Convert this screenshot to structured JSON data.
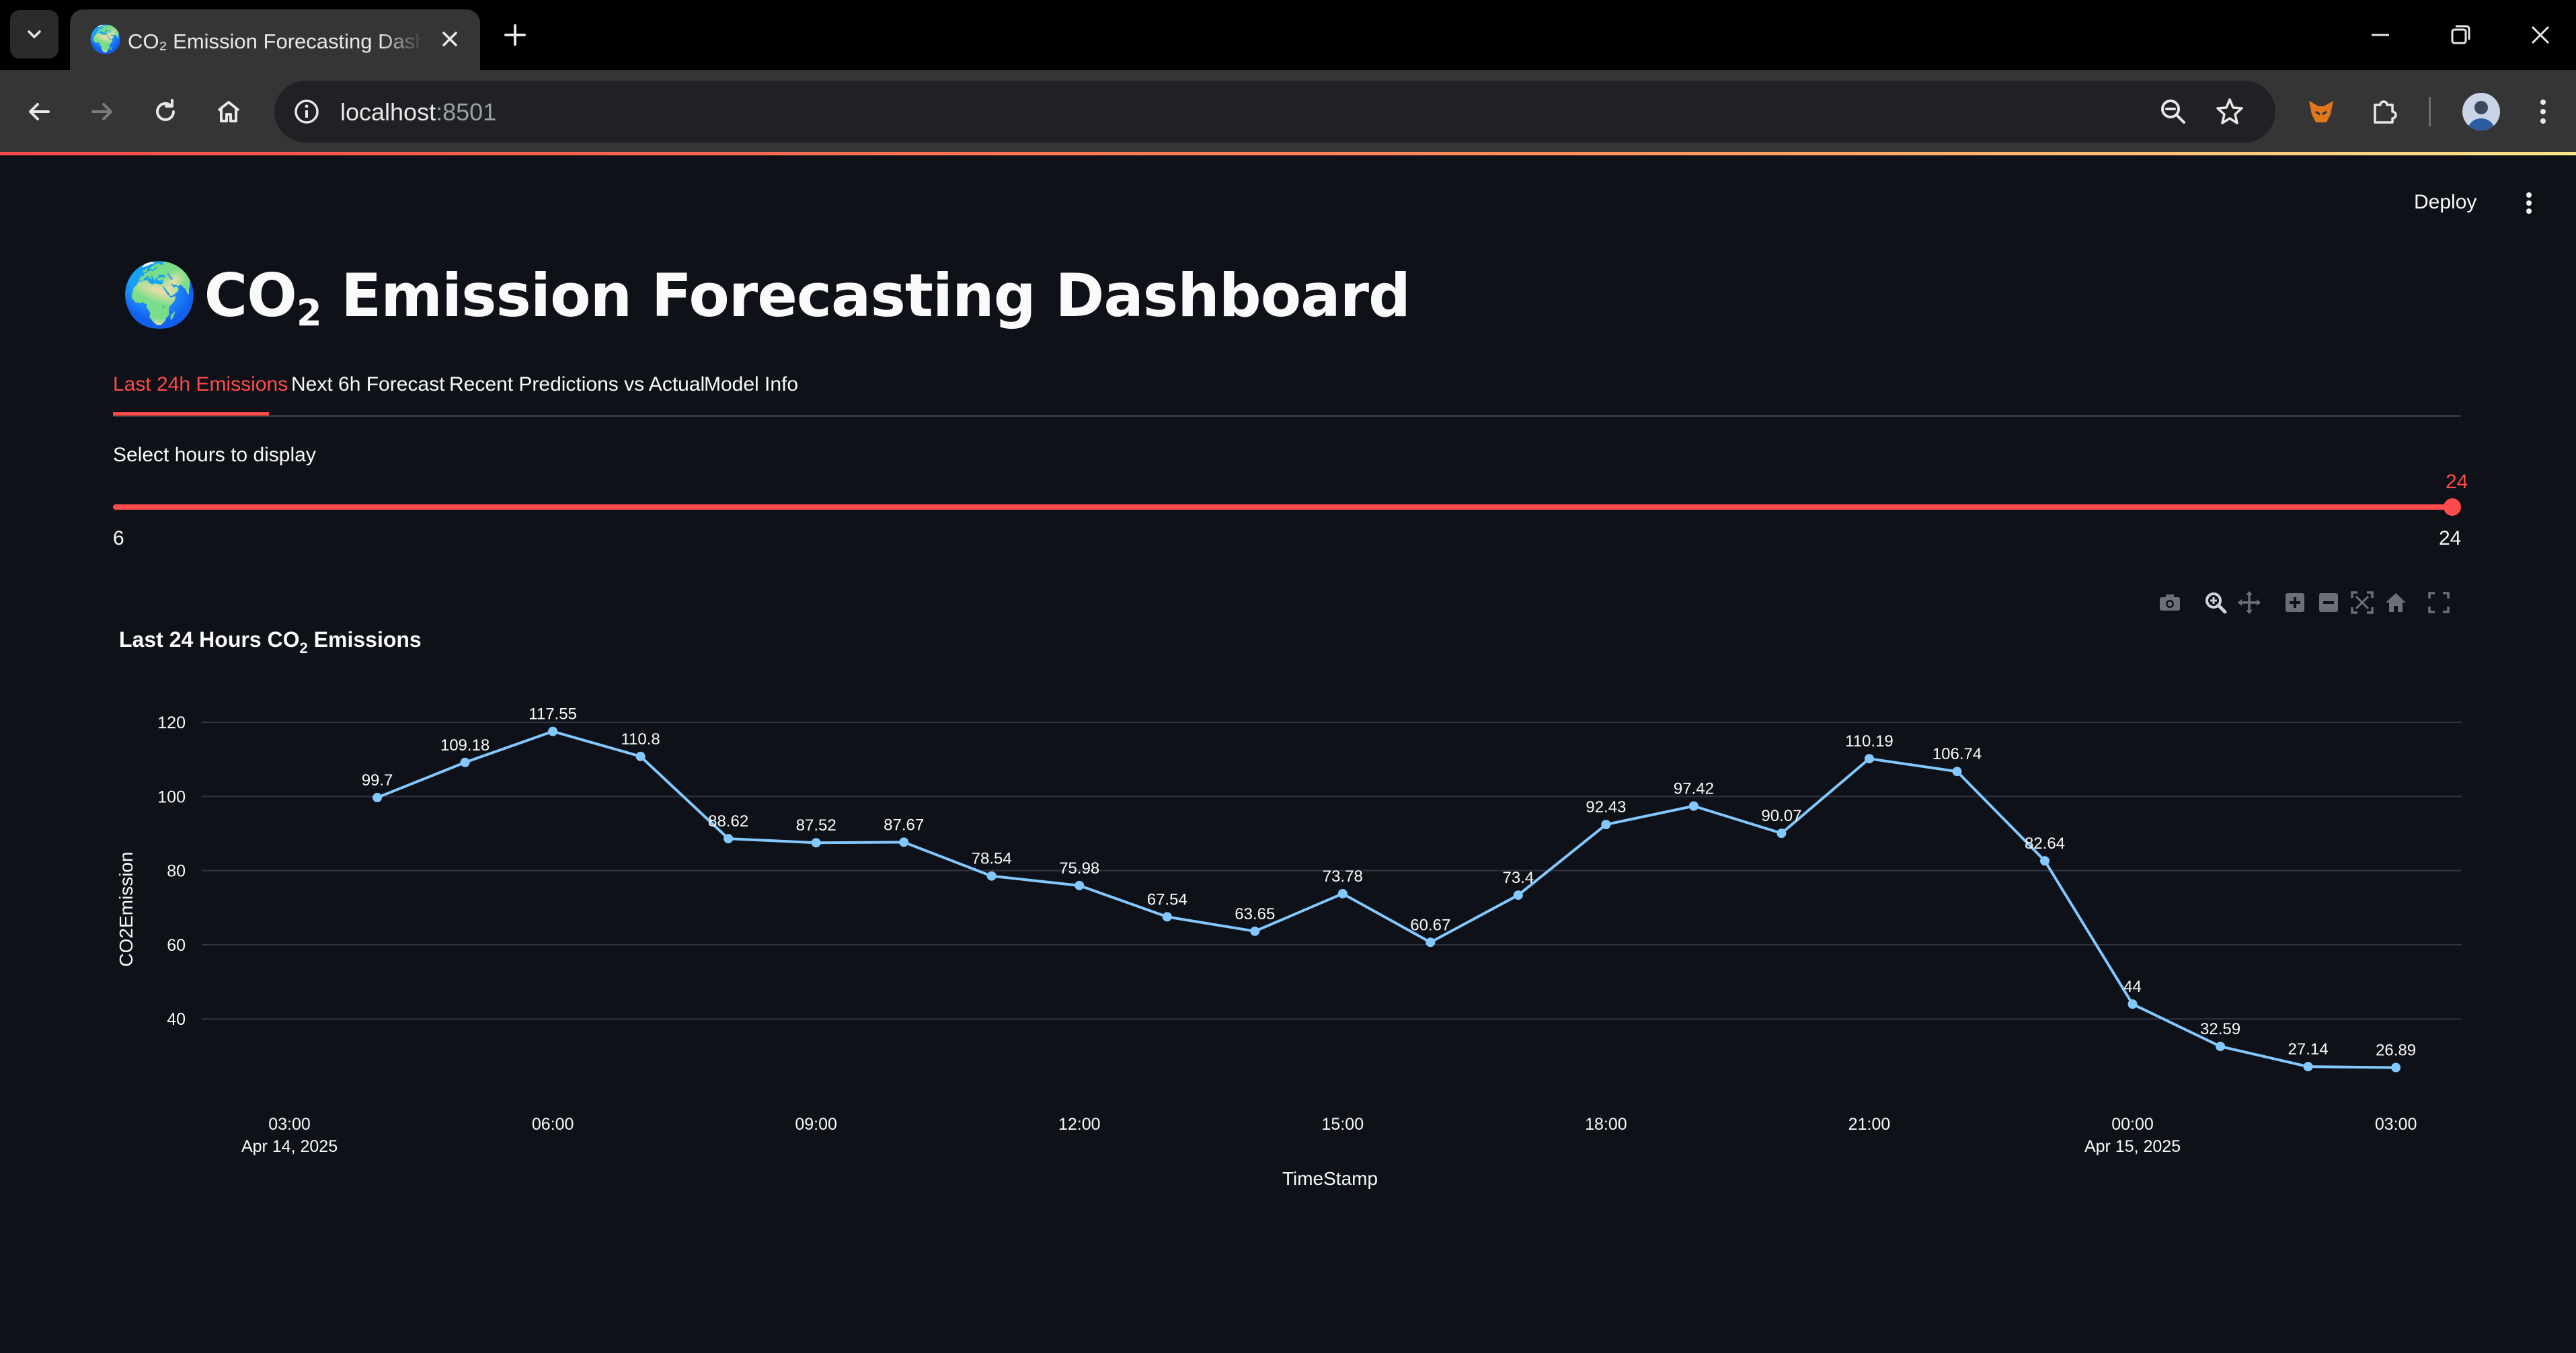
{
  "browser": {
    "tab_title": "CO₂ Emission Forecasting Dashboard",
    "tab_favicon": "🌍",
    "url_host": "localhost",
    "url_port": ":8501"
  },
  "header": {
    "deploy_label": "Deploy"
  },
  "title": {
    "icon": "🌍",
    "prefix": "CO",
    "subscript": "2",
    "suffix": " Emission Forecasting Dashboard"
  },
  "tabs": [
    {
      "label": "Last 24h Emissions",
      "active": true
    },
    {
      "label": "Next 6h Forecast",
      "active": false
    },
    {
      "label": "Recent Predictions vs Actual",
      "active": false
    },
    {
      "label": "Model Info",
      "active": false
    }
  ],
  "slider": {
    "label": "Select hours to display",
    "min": 6,
    "max": 24,
    "value": 24
  },
  "colors": {
    "accent": "#ff4b4b",
    "line": "#83c9ff",
    "background": "#0e1117",
    "grid": "#31333f"
  },
  "chart_data": {
    "type": "line",
    "title_prefix": "Last 24 Hours CO",
    "title_sub": "2",
    "title_suffix": " Emissions",
    "xlabel": "TimeStamp",
    "ylabel": "CO2Emission",
    "x": [
      "2025-04-14 04:00",
      "2025-04-14 05:00",
      "2025-04-14 06:00",
      "2025-04-14 07:00",
      "2025-04-14 08:00",
      "2025-04-14 09:00",
      "2025-04-14 10:00",
      "2025-04-14 11:00",
      "2025-04-14 12:00",
      "2025-04-14 13:00",
      "2025-04-14 14:00",
      "2025-04-14 15:00",
      "2025-04-14 16:00",
      "2025-04-14 17:00",
      "2025-04-14 18:00",
      "2025-04-14 19:00",
      "2025-04-14 20:00",
      "2025-04-14 21:00",
      "2025-04-14 22:00",
      "2025-04-14 23:00",
      "2025-04-15 00:00",
      "2025-04-15 01:00",
      "2025-04-15 02:00",
      "2025-04-15 03:00"
    ],
    "values": [
      99.7,
      109.18,
      117.55,
      110.8,
      88.62,
      87.52,
      87.67,
      78.54,
      75.98,
      67.54,
      63.65,
      73.78,
      60.67,
      73.4,
      92.43,
      97.42,
      90.07,
      110.19,
      106.74,
      82.64,
      44,
      32.59,
      27.14,
      26.89
    ],
    "labels": [
      "99.7",
      "109.18",
      "117.55",
      "110.8",
      "88.62",
      "87.52",
      "87.67",
      "78.54",
      "75.98",
      "67.54",
      "63.65",
      "73.78",
      "60.67",
      "73.4",
      "92.43",
      "97.42",
      "90.07",
      "110.19",
      "106.74",
      "82.64",
      "44",
      "32.59",
      "27.14",
      "26.89"
    ],
    "x_ticks": [
      {
        "line1": "03:00",
        "line2": "Apr 14, 2025"
      },
      {
        "line1": "06:00",
        "line2": ""
      },
      {
        "line1": "09:00",
        "line2": ""
      },
      {
        "line1": "12:00",
        "line2": ""
      },
      {
        "line1": "15:00",
        "line2": ""
      },
      {
        "line1": "18:00",
        "line2": ""
      },
      {
        "line1": "21:00",
        "line2": ""
      },
      {
        "line1": "00:00",
        "line2": "Apr 15, 2025"
      },
      {
        "line1": "03:00",
        "line2": ""
      }
    ],
    "y_ticks": [
      40,
      60,
      80,
      100,
      120
    ],
    "xlim": [
      "2025-04-14 02:00",
      "2025-04-15 03:45"
    ],
    "ylim": [
      21,
      128
    ],
    "grid": true,
    "mode": "lines+markers+text"
  },
  "modebar_icons": [
    "camera-icon",
    "zoom-icon",
    "pan-icon",
    "zoom-in-icon",
    "zoom-out-icon",
    "autoscale-icon",
    "reset-axes-icon",
    "fullscreen-icon"
  ]
}
